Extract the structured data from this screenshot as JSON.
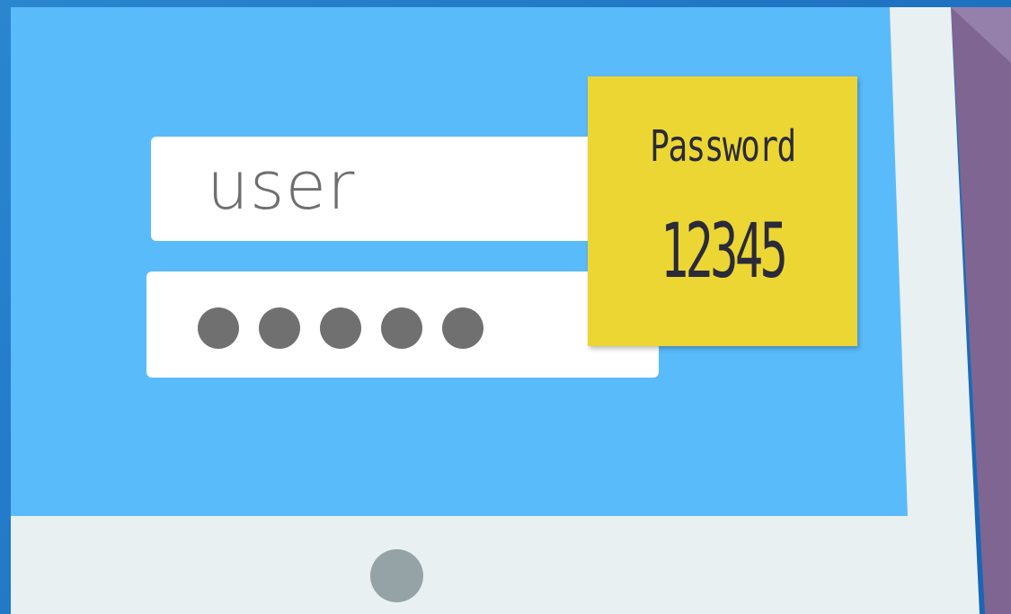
{
  "login_form": {
    "username_value": "user",
    "password_mask_count": 5
  },
  "sticky_note": {
    "label": "Password",
    "code": "12345"
  },
  "colors": {
    "background": "#2a86cf",
    "screen": "#5abbfa",
    "bezel": "#e9f0f1",
    "sticky_note": "#ecd633",
    "purple_panel": "#7f6591",
    "home_button": "#95a3a6",
    "password_dot": "#707070"
  }
}
